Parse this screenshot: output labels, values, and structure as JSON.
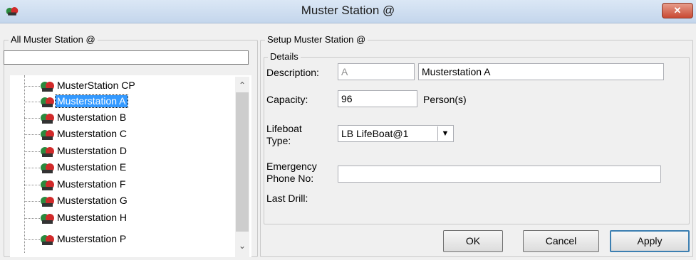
{
  "window": {
    "title": "Muster Station @",
    "close_label": "✕"
  },
  "left_panel": {
    "legend": "All Muster Station @",
    "filter_value": "",
    "stations": [
      {
        "label": "MusterStation CP",
        "selected": false
      },
      {
        "label": "Musterstation A",
        "selected": true
      },
      {
        "label": "Musterstation B",
        "selected": false
      },
      {
        "label": "Musterstation C",
        "selected": false
      },
      {
        "label": "Musterstation D",
        "selected": false
      },
      {
        "label": "Musterstation E",
        "selected": false
      },
      {
        "label": "Musterstation F",
        "selected": false
      },
      {
        "label": "Musterstation G",
        "selected": false
      },
      {
        "label": "Musterstation H",
        "selected": false
      },
      {
        "label": "Musterstation P",
        "selected": false
      }
    ],
    "scroll_up": "⌃",
    "scroll_down": "⌄"
  },
  "setup": {
    "legend": "Setup Muster Station @",
    "details_legend": "Details",
    "description_label": "Description:",
    "description_code": "A",
    "description_value": "Musterstation A",
    "capacity_label": "Capacity:",
    "capacity_value": "96",
    "capacity_unit": "Person(s)",
    "lifeboat_label_1": "Lifeboat",
    "lifeboat_label_2": "Type:",
    "lifeboat_value": "LB LifeBoat@1",
    "emergency_label_1": "Emergency",
    "emergency_label_2": "Phone No:",
    "emergency_value": "",
    "last_drill_label": "Last Drill:"
  },
  "buttons": {
    "ok": "OK",
    "cancel": "Cancel",
    "apply": "Apply"
  },
  "colors": {
    "selection": "#3399ff",
    "close": "#c94a33"
  }
}
